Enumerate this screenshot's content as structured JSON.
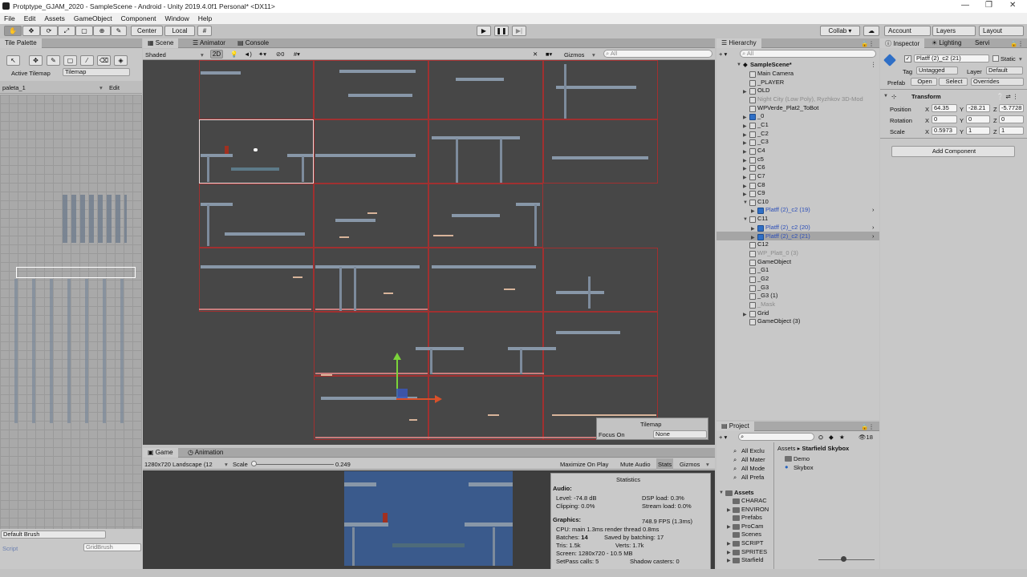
{
  "window": {
    "title": "Protptype_GJAM_2020 - SampleScene - Android - Unity 2019.4.0f1 Personal* <DX11>"
  },
  "menu": [
    "File",
    "Edit",
    "Assets",
    "GameObject",
    "Component",
    "Window",
    "Help"
  ],
  "toolbar": {
    "center": "Center",
    "local": "Local",
    "collab": "Collab ▾",
    "account": "Account",
    "layers": "Layers",
    "layout": "Layout"
  },
  "tilepalette": {
    "tab": "Tile Palette",
    "active_tilemap_label": "Active Tilemap",
    "active_tilemap_value": "Tilemap",
    "palette_name": "paleta_1",
    "edit": "Edit",
    "brush": "Default Brush",
    "script_label": "Script",
    "script_value": "GridBrush"
  },
  "scene": {
    "tabs": [
      "Scene",
      "Animator",
      "Console"
    ],
    "shaded": "Shaded",
    "mode2d": "2D",
    "gizmos": "Gizmos",
    "search_placeholder": "All",
    "fx_count": "0",
    "tilemap_overlay_title": "Tilemap",
    "focus_on_label": "Focus On",
    "focus_on_value": "None"
  },
  "game": {
    "tabs": [
      "Game",
      "Animation"
    ],
    "resolution": "1280x720 Landscape (12",
    "scale_label": "Scale",
    "scale_value": "0.249",
    "buttons": [
      "Maximize On Play",
      "Mute Audio",
      "Stats",
      "Gizmos"
    ],
    "stats": {
      "title": "Statistics",
      "audio": "Audio:",
      "level": "Level: -74.8 dB",
      "clipping": "Clipping: 0.0%",
      "dsp": "DSP load: 0.3%",
      "stream": "Stream load: 0.0%",
      "graphics": "Graphics:",
      "fps": "748.9 FPS (1.3ms)",
      "cpu": "CPU: main 1.3ms  render thread 0.8ms",
      "batches_label": "Batches:",
      "batches_value": "14",
      "saved": "Saved by batching: 17",
      "tris": "Tris: 1.5k",
      "verts": "Verts: 1.7k",
      "screen": "Screen: 1280x720 - 10.5 MB",
      "setpass": "SetPass calls: 5",
      "shadow": "Shadow casters: 0"
    }
  },
  "hierarchy": {
    "tab": "Hierarchy",
    "search_placeholder": "All",
    "scene": "SampleScene*",
    "items": [
      {
        "label": "Main Camera",
        "style": "normal"
      },
      {
        "label": "_PLAYER",
        "style": "normal"
      },
      {
        "label": "OLD",
        "style": "normal"
      },
      {
        "label": "Night City (Low Poly), Ryzhkov 3D-Mod",
        "style": "grey"
      },
      {
        "label": "WPVerde_Plat2_ToBot",
        "style": "normal"
      },
      {
        "label": "_0",
        "style": "normal"
      },
      {
        "label": "_C1",
        "style": "normal"
      },
      {
        "label": "_C2",
        "style": "normal"
      },
      {
        "label": "_C3",
        "style": "normal"
      },
      {
        "label": "C4",
        "style": "normal"
      },
      {
        "label": "c5",
        "style": "normal"
      },
      {
        "label": "C6",
        "style": "normal"
      },
      {
        "label": "C7",
        "style": "normal"
      },
      {
        "label": "C8",
        "style": "normal"
      },
      {
        "label": "C9",
        "style": "normal"
      },
      {
        "label": "C10",
        "style": "normal"
      },
      {
        "label": "Platff (2)_c2 (19)",
        "style": "blue"
      },
      {
        "label": "C11",
        "style": "normal"
      },
      {
        "label": "Platff (2)_c2 (20)",
        "style": "blue"
      },
      {
        "label": "Platff (2)_c2 (21)",
        "style": "blue"
      },
      {
        "label": "C12",
        "style": "normal"
      },
      {
        "label": "WP_Platt_0 (3)",
        "style": "grey"
      },
      {
        "label": "GameObject",
        "style": "normal"
      },
      {
        "label": "_G1",
        "style": "normal"
      },
      {
        "label": "_G2",
        "style": "normal"
      },
      {
        "label": "_G3",
        "style": "normal"
      },
      {
        "label": "_G3 (1)",
        "style": "normal"
      },
      {
        "label": "_Mask",
        "style": "grey"
      },
      {
        "label": "Grid",
        "style": "normal"
      },
      {
        "label": "GameObject (3)",
        "style": "normal"
      }
    ]
  },
  "project": {
    "tab": "Project",
    "count": "18",
    "breadcrumb_root": "Assets",
    "breadcrumb_leaf": "Starfield Skybox",
    "favorites": [
      "All Exclu",
      "All Mater",
      "All Mode",
      "All Prefa"
    ],
    "assets_root": "Assets",
    "folders": [
      "CHARAC",
      "ENVIRON",
      "Prefabs",
      "ProCam",
      "Scenes",
      "SCRIPT",
      "SPRITES",
      "Starfield"
    ],
    "contents": [
      "Demo",
      "Skybox"
    ]
  },
  "inspector": {
    "tabs": [
      "Inspector",
      "Lighting",
      "Servi"
    ],
    "object_name": "Platff (2)_c2 (21)",
    "static": "Static",
    "tag_label": "Tag",
    "tag_value": "Untagged",
    "layer_label": "Layer",
    "layer_value": "Default",
    "prefab_label": "Prefab",
    "open": "Open",
    "select": "Select",
    "overrides": "Overrides",
    "transform": "Transform",
    "position": "Position",
    "rotation": "Rotation",
    "scale": "Scale",
    "pos": {
      "x": "64.35",
      "y": "-28.21",
      "z": "-5.7728"
    },
    "rot": {
      "x": "0",
      "y": "0",
      "z": "0"
    },
    "scl": {
      "x": "0.5973",
      "y": "1",
      "z": "1"
    },
    "add_component": "Add Component"
  }
}
